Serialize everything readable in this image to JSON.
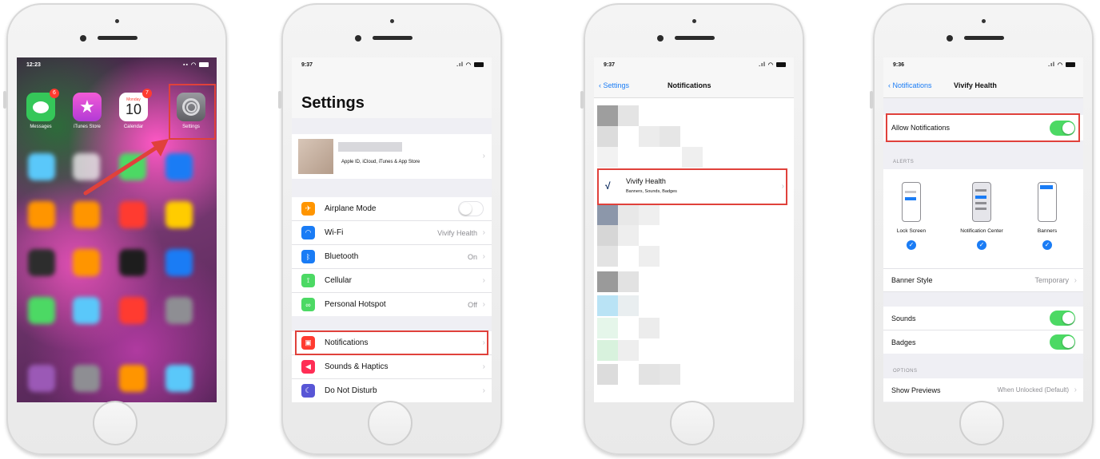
{
  "phone1": {
    "time": "12:23",
    "apps": [
      {
        "label": "Messages",
        "badge": "6",
        "icon": "messages-icon",
        "color": "#35c759"
      },
      {
        "label": "iTunes Store",
        "badge": "",
        "icon": "star-icon",
        "color": "#d84bd6"
      },
      {
        "label": "Calendar",
        "badge": "7",
        "icon": "calendar-icon",
        "color": "#ffffff",
        "day": "Monday",
        "date": "10"
      },
      {
        "label": "Settings",
        "badge": "",
        "icon": "gear-icon",
        "color": "#8e8e93"
      }
    ]
  },
  "phone2": {
    "time": "9:37",
    "title": "Settings",
    "account_subtitle": "Apple ID, iCloud, iTunes & App Store",
    "rows1": [
      {
        "label": "Airplane Mode",
        "value": "",
        "icon": "airplane-icon",
        "color": "#ff9500"
      },
      {
        "label": "Wi-Fi",
        "value": "Vivify Health",
        "icon": "wifi-icon",
        "color": "#1a7cf5"
      },
      {
        "label": "Bluetooth",
        "value": "On",
        "icon": "bluetooth-icon",
        "color": "#1a7cf5"
      },
      {
        "label": "Cellular",
        "value": "",
        "icon": "cellular-icon",
        "color": "#4cd964"
      },
      {
        "label": "Personal Hotspot",
        "value": "Off",
        "icon": "hotspot-icon",
        "color": "#4cd964"
      }
    ],
    "rows2": [
      {
        "label": "Notifications",
        "value": "",
        "icon": "notifications-icon",
        "color": "#ff3b30"
      },
      {
        "label": "Sounds & Haptics",
        "value": "",
        "icon": "speaker-icon",
        "color": "#ff2d55"
      },
      {
        "label": "Do Not Disturb",
        "value": "",
        "icon": "moon-icon",
        "color": "#5856d6"
      }
    ]
  },
  "phone3": {
    "time": "9:37",
    "back": "Settings",
    "title": "Notifications",
    "app_name": "Vivify Health",
    "app_subtitle": "Banners, Sounds, Badges"
  },
  "phone4": {
    "time": "9:36",
    "back": "Notifications",
    "title": "Vivify Health",
    "allow": "Allow Notifications",
    "alerts_header": "ALERTS",
    "styles": [
      "Lock Screen",
      "Notification Center",
      "Banners"
    ],
    "banner_style_label": "Banner Style",
    "banner_style_value": "Temporary",
    "sounds": "Sounds",
    "badges": "Badges",
    "options_header": "OPTIONS",
    "previews_label": "Show Previews",
    "previews_value": "When Unlocked (Default)"
  },
  "colors": {
    "accent": "#1a7cf5",
    "highlight": "#e0413b",
    "toggle_on": "#4cd964"
  }
}
